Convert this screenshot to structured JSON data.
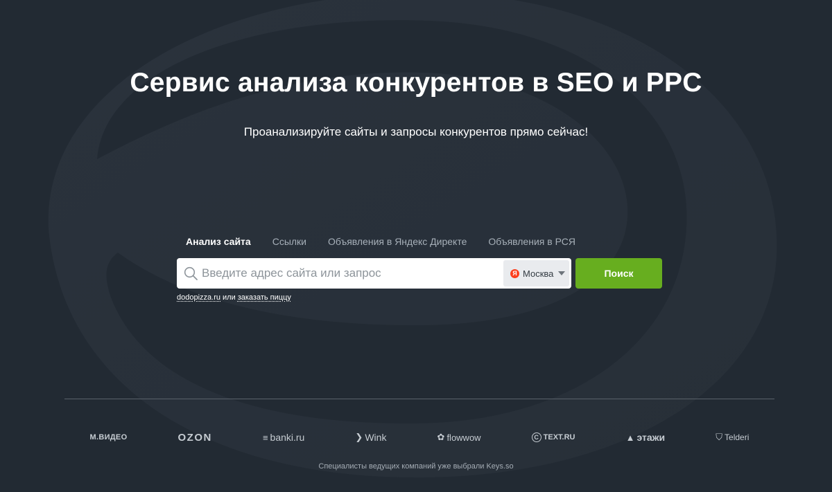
{
  "hero": {
    "title": "Сервис анализа конкурентов в SEO и PPC",
    "subtitle": "Проанализируйте сайты и запросы конкурентов прямо сейчас!"
  },
  "tabs": [
    {
      "label": "Анализ сайта",
      "active": true
    },
    {
      "label": "Ссылки",
      "active": false
    },
    {
      "label": "Объявления в Яндекс Директе",
      "active": false
    },
    {
      "label": "Объявления в РСЯ",
      "active": false
    }
  ],
  "search": {
    "placeholder": "Введите адрес сайта или запрос",
    "value": "",
    "region_icon_letter": "Я",
    "region": "Москва",
    "button_label": "Поиск"
  },
  "examples": {
    "first": "dodopizza.ru",
    "separator": "или",
    "second": "заказать пиццу"
  },
  "clients": {
    "logos": [
      {
        "name": "mvideo",
        "text": "М.ВИДЕО"
      },
      {
        "name": "ozon",
        "text": "OZON"
      },
      {
        "name": "banki",
        "text": "banki.ru"
      },
      {
        "name": "wink",
        "text": "Wink"
      },
      {
        "name": "flowwow",
        "text": "flowwow"
      },
      {
        "name": "textru",
        "text": "TEXT.RU"
      },
      {
        "name": "etazhi",
        "text": "этажи"
      },
      {
        "name": "telderi",
        "text": "Telderi"
      }
    ],
    "caption": "Специалисты ведущих компаний уже выбрали Keys.so"
  },
  "colors": {
    "background": "#222a33",
    "accent_button": "#67ae1f",
    "yandex_red": "#fc3f1d"
  }
}
